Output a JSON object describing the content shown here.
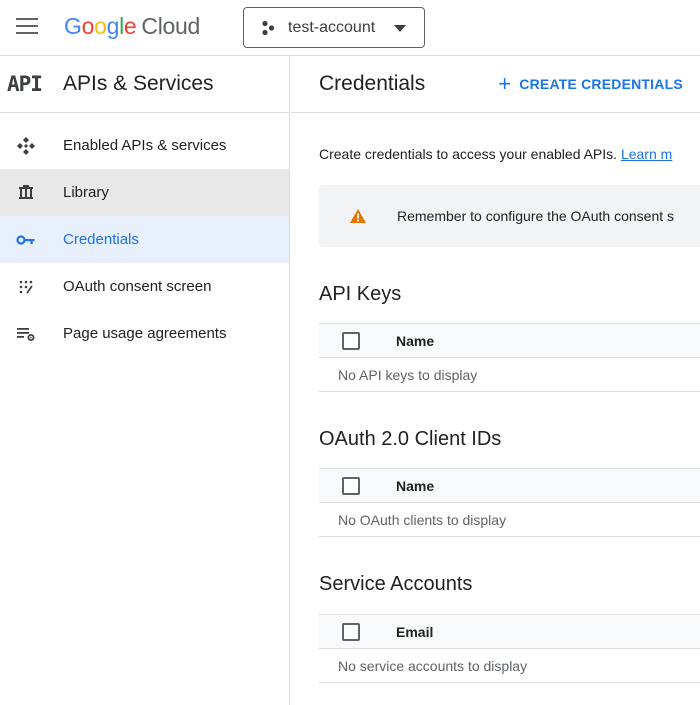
{
  "topbar": {
    "logo": {
      "g1": "G",
      "o1": "o",
      "o2": "o",
      "g2": "g",
      "l": "l",
      "e": "e",
      "cloud": "Cloud"
    },
    "project_name": "test-account"
  },
  "sidebar": {
    "badge": "API",
    "title": "APIs & Services",
    "items": [
      {
        "label": "Enabled APIs & services",
        "icon": "enabled-apis-icon"
      },
      {
        "label": "Library",
        "icon": "library-icon"
      },
      {
        "label": "Credentials",
        "icon": "key-icon"
      },
      {
        "label": "OAuth consent screen",
        "icon": "oauth-consent-icon"
      },
      {
        "label": "Page usage agreements",
        "icon": "settings-list-icon"
      }
    ]
  },
  "main": {
    "title": "Credentials",
    "create_label": "CREATE CREDENTIALS",
    "create_plus": "+",
    "intro_text": "Create credentials to access your enabled APIs.",
    "intro_link": "Learn m",
    "notice_text": "Remember to configure the OAuth consent s",
    "sections": {
      "api_keys": {
        "title": "API Keys",
        "column": "Name",
        "empty": "No API keys to display"
      },
      "oauth": {
        "title": "OAuth 2.0 Client IDs",
        "column": "Name",
        "empty": "No OAuth clients to display"
      },
      "service_accounts": {
        "title": "Service Accounts",
        "column": "Email",
        "empty": "No service accounts to display"
      }
    }
  },
  "colors": {
    "accent": "#1a73e8",
    "active_bg": "#e8f0fe",
    "hover_bg": "#e8e8e8",
    "warning": "#e37400",
    "notice_bg": "#f1f3f4"
  }
}
